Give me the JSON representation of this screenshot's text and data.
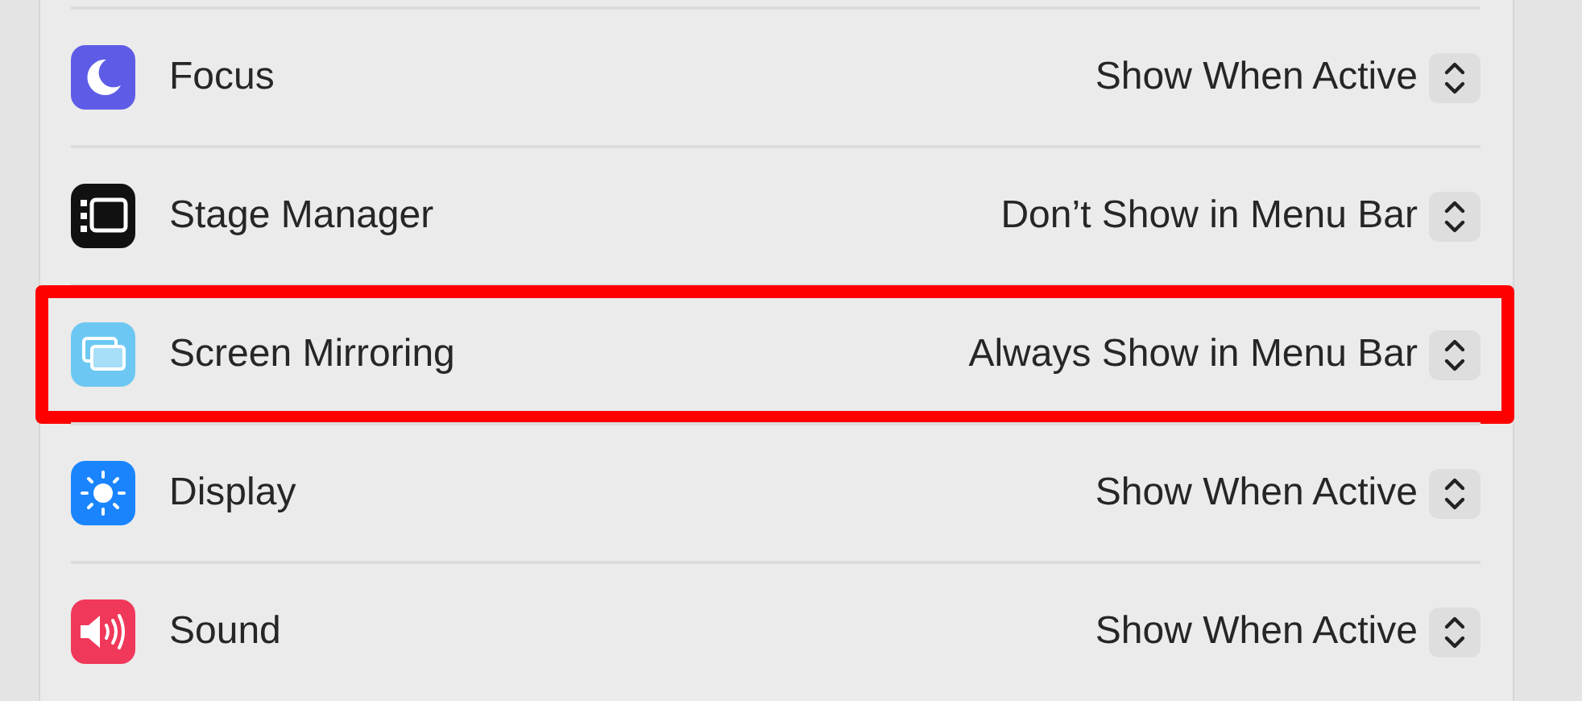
{
  "items": [
    {
      "kind": "focus",
      "label": "Focus",
      "value": "Show When Active",
      "highlighted": false
    },
    {
      "kind": "stage-manager",
      "label": "Stage Manager",
      "value": "Don’t Show in Menu Bar",
      "highlighted": false
    },
    {
      "kind": "screen-mirroring",
      "label": "Screen Mirroring",
      "value": "Always Show in Menu Bar",
      "highlighted": true
    },
    {
      "kind": "display",
      "label": "Display",
      "value": "Show When Active",
      "highlighted": false
    },
    {
      "kind": "sound",
      "label": "Sound",
      "value": "Show When Active",
      "highlighted": false
    }
  ]
}
